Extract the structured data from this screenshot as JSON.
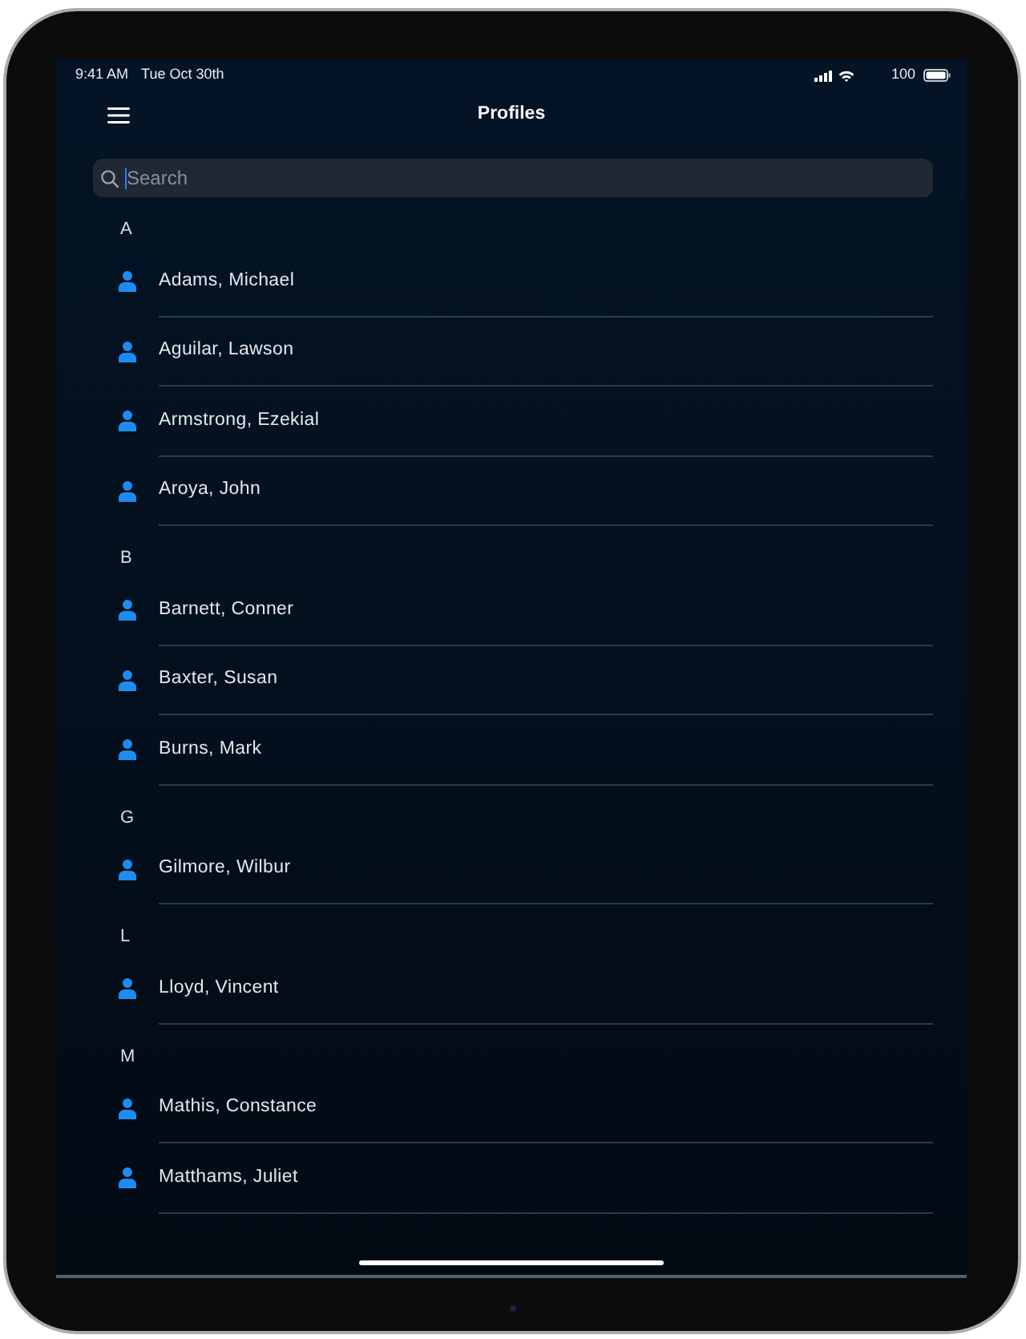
{
  "status_bar": {
    "time": "9:41 AM",
    "date": "Tue Oct 30th",
    "battery": "100"
  },
  "header": {
    "title": "Profiles"
  },
  "search": {
    "placeholder": "Search",
    "focused": true
  },
  "sections": [
    {
      "letter": "A",
      "profiles": [
        "Adams, Michael",
        "Aguilar, Lawson",
        "Armstrong, Ezekial",
        "Aroya, John"
      ]
    },
    {
      "letter": "B",
      "profiles": [
        "Barnett, Conner",
        "Baxter, Susan",
        "Burns, Mark"
      ]
    },
    {
      "letter": "G",
      "profiles": [
        "Gilmore, Wilbur"
      ]
    },
    {
      "letter": "L",
      "profiles": [
        "Lloyd, Vincent"
      ]
    },
    {
      "letter": "M",
      "profiles": [
        "Mathis, Constance",
        "Matthams, Juliet"
      ]
    }
  ]
}
